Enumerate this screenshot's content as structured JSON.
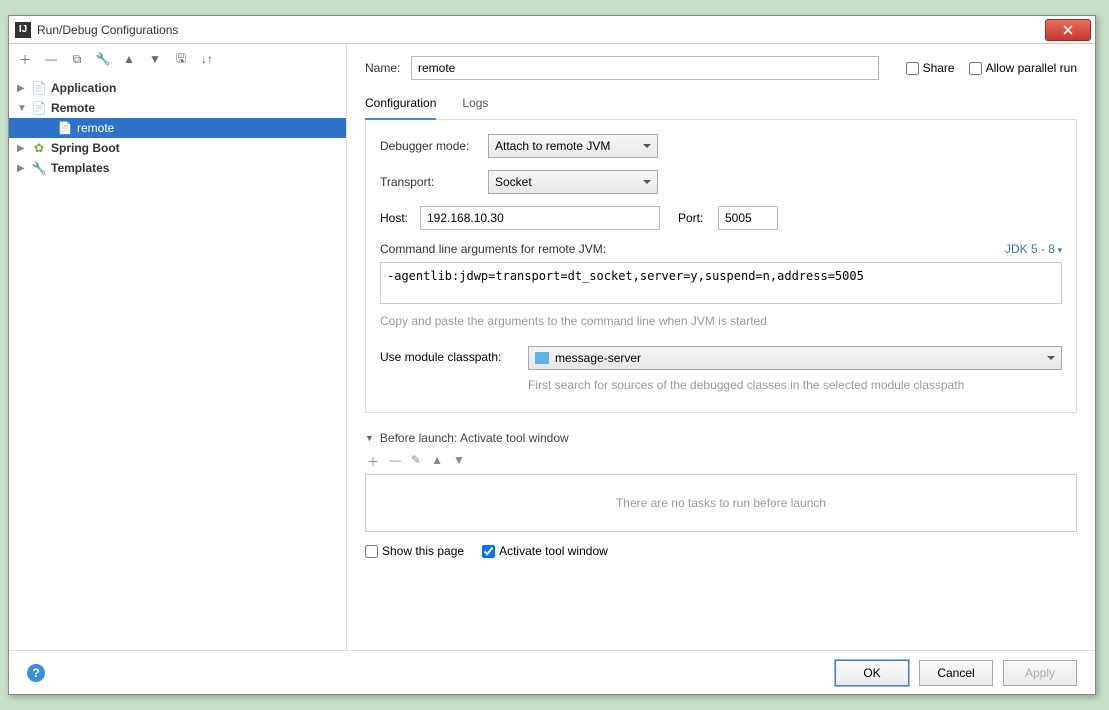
{
  "window": {
    "title": "Run/Debug Configurations"
  },
  "tree": {
    "application": "Application",
    "remote": "Remote",
    "remote_child": "remote",
    "spring": "Spring Boot",
    "templates": "Templates"
  },
  "form": {
    "name_label": "Name:",
    "name_value": "remote",
    "share": "Share",
    "allow_parallel": "Allow parallel run",
    "tab_config": "Configuration",
    "tab_logs": "Logs",
    "debugger_mode_label": "Debugger mode:",
    "debugger_mode_value": "Attach to remote JVM",
    "transport_label": "Transport:",
    "transport_value": "Socket",
    "host_label": "Host:",
    "host_value": "192.168.10.30",
    "port_label": "Port:",
    "port_value": "5005",
    "cmd_label": "Command line arguments for remote JVM:",
    "jdk_link": "JDK 5 - 8",
    "cmd_value": "-agentlib:jdwp=transport=dt_socket,server=y,suspend=n,address=5005",
    "cmd_hint": "Copy and paste the arguments to the command line when JVM is started",
    "module_label": "Use module classpath:",
    "module_value": "message-server",
    "module_hint": "First search for sources of the debugged classes in the selected module classpath",
    "before_launch_title": "Before launch: Activate tool window",
    "before_launch_empty": "There are no tasks to run before launch",
    "show_this_page": "Show this page",
    "activate_tool": "Activate tool window"
  },
  "buttons": {
    "ok": "OK",
    "cancel": "Cancel",
    "apply": "Apply"
  }
}
